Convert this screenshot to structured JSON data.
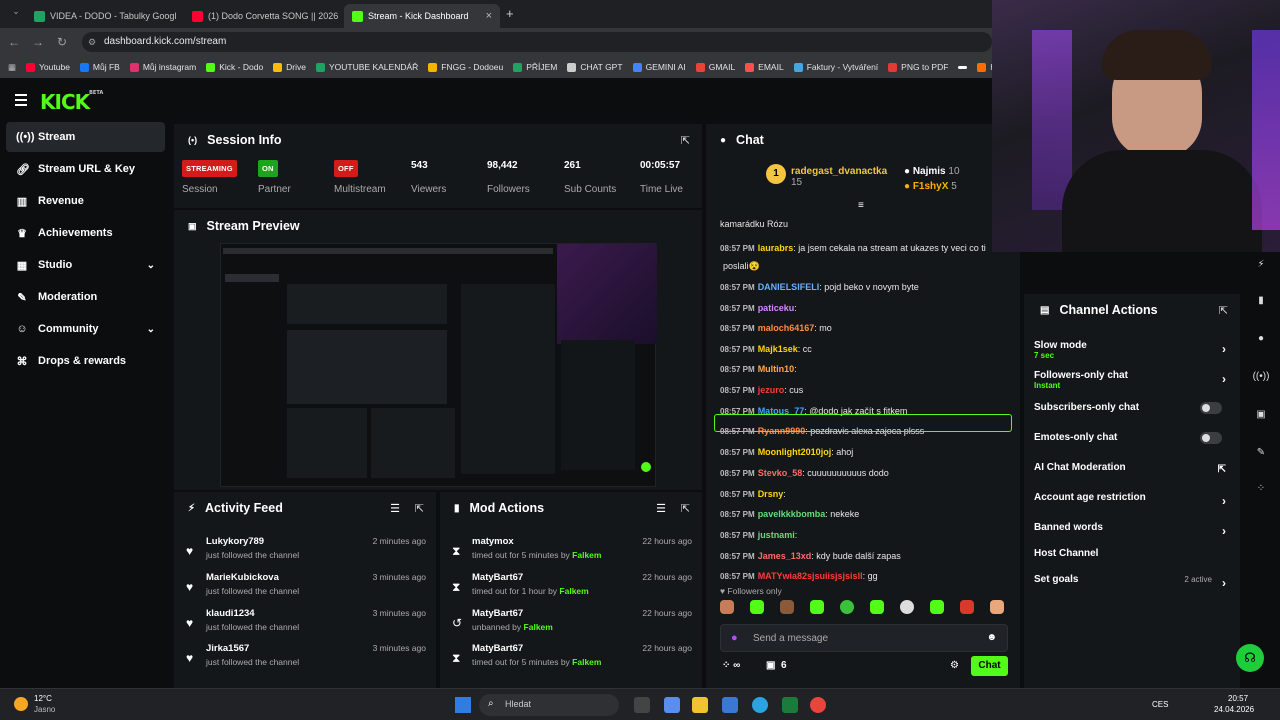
{
  "browser": {
    "tabs": [
      {
        "label": "VIDEA - DODO - Tabulky Googl",
        "color": "#1ea362"
      },
      {
        "label": "(1) Dodo Corvetta SONG || 2026",
        "color": "#ff0033"
      },
      {
        "label": "Stream - Kick Dashboard",
        "color": "#53fc18"
      }
    ],
    "url": "dashboard.kick.com/stream",
    "bookmarks": [
      {
        "label": "Youtube",
        "color": "#ff0033"
      },
      {
        "label": "Můj FB",
        "color": "#1877f2"
      },
      {
        "label": "Můj instagram",
        "color": "#e1306c"
      },
      {
        "label": "Kick - Dodo",
        "color": "#53fc18"
      },
      {
        "label": "Drive",
        "color": "#fbbc04"
      },
      {
        "label": "YOUTUBE KALENDÁŘ",
        "color": "#1ea362"
      },
      {
        "label": "FNGG - Dodoeu",
        "color": "#f4b400"
      },
      {
        "label": "PŘÍJEM",
        "color": "#1ea362"
      },
      {
        "label": "CHAT GPT",
        "color": "#cccccc"
      },
      {
        "label": "GEMINI AI",
        "color": "#4285f4"
      },
      {
        "label": "GMAIL",
        "color": "#ea4335"
      },
      {
        "label": "EMAIL",
        "color": "#ff4d4d"
      },
      {
        "label": "Faktury - Vytváření",
        "color": "#4aa3df"
      },
      {
        "label": "PNG to PDF",
        "color": "#e53935"
      },
      {
        "label": "",
        "color": "#ffffff"
      },
      {
        "label": "htt",
        "color": "#ff6d00"
      }
    ]
  },
  "brand": {
    "name": "KICK",
    "beta": "BETA",
    "accent": "#53fc18"
  },
  "sidebar": {
    "items": [
      {
        "label": "Stream",
        "icon": "broadcast-icon"
      },
      {
        "label": "Stream URL & Key",
        "icon": "link-icon"
      },
      {
        "label": "Revenue",
        "icon": "chart-icon"
      },
      {
        "label": "Achievements",
        "icon": "trophy-icon"
      },
      {
        "label": "Studio",
        "icon": "grid-icon"
      },
      {
        "label": "Moderation",
        "icon": "wrench-icon"
      },
      {
        "label": "Community",
        "icon": "people-icon"
      },
      {
        "label": "Drops & rewards",
        "icon": "gift-icon"
      }
    ]
  },
  "session": {
    "title": "Session Info",
    "stats": [
      {
        "value": "STREAMING",
        "label": "Session"
      },
      {
        "value": "ON",
        "label": "Partner"
      },
      {
        "value": "OFF",
        "label": "Multistream"
      },
      {
        "value": "543",
        "label": "Viewers"
      },
      {
        "value": "98,442",
        "label": "Followers"
      },
      {
        "value": "261",
        "label": "Sub Counts"
      },
      {
        "value": "00:05:57",
        "label": "Time Live"
      }
    ]
  },
  "preview": {
    "title": "Stream Preview"
  },
  "activity": {
    "title": "Activity Feed",
    "items": [
      {
        "name": "Lukykory789",
        "sub": "just followed the channel",
        "time": "2 minutes ago"
      },
      {
        "name": "MarieKubickova",
        "sub": "just followed the channel",
        "time": "3 minutes ago"
      },
      {
        "name": "klaudi1234",
        "sub": "just followed the channel",
        "time": "3 minutes ago"
      },
      {
        "name": "Jirka1567",
        "sub": "just followed the channel",
        "time": "3 minutes ago"
      }
    ]
  },
  "mod": {
    "title": "Mod Actions",
    "items": [
      {
        "name": "matymox",
        "sub": "timed out for 5 minutes by",
        "by": "Falkem",
        "time": "22 hours ago",
        "icon": "hourglass-icon"
      },
      {
        "name": "MatyBart67",
        "sub": "timed out for 1 hour by",
        "by": "Falkem",
        "time": "22 hours ago",
        "icon": "hourglass-icon"
      },
      {
        "name": "MatyBart67",
        "sub": "unbanned by",
        "by": "Falkem",
        "time": "22 hours ago",
        "icon": "undo-icon"
      },
      {
        "name": "MatyBart67",
        "sub": "timed out for 5 minutes by",
        "by": "Falkem",
        "time": "22 hours ago",
        "icon": "hourglass-icon"
      }
    ]
  },
  "chat": {
    "title": "Chat",
    "leaderboard": [
      {
        "rank": "1",
        "name": "radegast_dvanactka",
        "count": "15",
        "color": "#f4c542"
      },
      {
        "rank": "",
        "name": "Najmis",
        "count": "10",
        "color": "#ffffff"
      },
      {
        "rank": "",
        "name": "F1shyX",
        "count": "5",
        "color": "#ffb000"
      }
    ],
    "pinned_text": "kamarádku Rózu",
    "messages": [
      {
        "time": "08:57 PM",
        "user": "laurabrs",
        "color": "#ffd60a",
        "text": ": ja jsem cekala na stream at ukazes ty veci co ti"
      },
      {
        "time": "",
        "user": "",
        "color": "#ffffff",
        "text": "poslali😵"
      },
      {
        "time": "08:57 PM",
        "user": "DANIELSIFELI",
        "color": "#6ab0ff",
        "text": ": pojd beko v novym byte"
      },
      {
        "time": "08:57 PM",
        "user": "paticeku",
        "color": "#d28cff",
        "text": ":"
      },
      {
        "time": "08:57 PM",
        "user": "maloch64167",
        "color": "#ff8c42",
        "text": ": mo"
      },
      {
        "time": "08:57 PM",
        "user": "Majk1sek",
        "color": "#ffd60a",
        "text": ": cc"
      },
      {
        "time": "08:57 PM",
        "user": "Multin10",
        "color": "#ffa94d",
        "text": ":"
      },
      {
        "time": "08:57 PM",
        "user": "jezuro",
        "color": "#ff3b3b",
        "text": ": cus"
      },
      {
        "time": "08:57 PM",
        "user": "Matous_77",
        "color": "#4aa3ff",
        "text": ": @dodo jak začít s fitkem"
      },
      {
        "time": "08:57 PM",
        "user": "Ryann9990",
        "color": "#ff8c42",
        "text": ": pozdravis alexa zajoca plsss"
      },
      {
        "time": "08:57 PM",
        "user": "Moonlight2010joj",
        "color": "#ffd60a",
        "text": ": ahoj"
      },
      {
        "time": "08:57 PM",
        "user": "Stevko_58",
        "color": "#ff6b6b",
        "text": ": cuuuuuuuuuus dodo"
      },
      {
        "time": "08:57 PM",
        "user": "Drsny",
        "color": "#ffd60a",
        "text": ":"
      },
      {
        "time": "08:57 PM",
        "user": "pavelkkkbomba",
        "color": "#69db7c",
        "text": ": nekeke"
      },
      {
        "time": "08:57 PM",
        "user": "justnami",
        "color": "#69db7c",
        "text": ":"
      },
      {
        "time": "08:57 PM",
        "user": "James_13xd",
        "color": "#ff6b6b",
        "text": ": kdy bude další zapas"
      },
      {
        "time": "08:57 PM",
        "user": "MATYwia82sjsuiisjsjsisll",
        "color": "#ff3b3b",
        "text": ": gg"
      }
    ],
    "followers_only": "Followers only",
    "input_placeholder": "Send a message",
    "send_label": "Chat",
    "viewer_count": "∞",
    "gift_count": "6"
  },
  "channel_actions": {
    "title": "Channel Actions",
    "items": [
      {
        "label": "Slow mode",
        "sub": "7 sec",
        "control": "arrow"
      },
      {
        "label": "Followers-only chat",
        "sub": "Instant",
        "control": "arrow"
      },
      {
        "label": "Subscribers-only chat",
        "sub": "",
        "control": "toggle"
      },
      {
        "label": "Emotes-only chat",
        "sub": "",
        "control": "toggle"
      },
      {
        "label": "AI Chat Moderation",
        "sub": "",
        "control": "external"
      },
      {
        "label": "Account age restriction",
        "sub": "",
        "control": "arrow"
      },
      {
        "label": "Banned words",
        "sub": "",
        "control": "arrow"
      },
      {
        "label": "Host Channel",
        "sub": "",
        "control": "none"
      },
      {
        "label": "Set goals",
        "sub": "",
        "control": "arrow",
        "extra": "2 active"
      }
    ]
  },
  "taskbar": {
    "weather_temp": "12°C",
    "weather_desc": "Jasno",
    "search_placeholder": "Hledat",
    "lang": "CES",
    "time": "20:57",
    "date": "24.04.2026"
  }
}
